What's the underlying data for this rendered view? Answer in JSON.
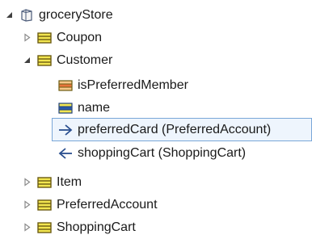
{
  "tree": {
    "root": {
      "label": "groceryStore",
      "icon": "package-icon",
      "expanded": true
    },
    "items": [
      {
        "label": "Coupon",
        "icon": "class-icon",
        "expanded": false
      },
      {
        "label": "Customer",
        "icon": "class-icon",
        "expanded": true,
        "children": [
          {
            "label": "isPreferredMember",
            "icon": "boolean-attribute-icon"
          },
          {
            "label": "name",
            "icon": "string-attribute-icon"
          },
          {
            "label": "preferredCard (PreferredAccount)",
            "icon": "reference-out-icon",
            "selected": true
          },
          {
            "label": "shoppingCart (ShoppingCart)",
            "icon": "reference-in-icon"
          }
        ]
      },
      {
        "label": "Item",
        "icon": "class-icon",
        "expanded": false
      },
      {
        "label": "PreferredAccount",
        "icon": "class-icon",
        "expanded": false
      },
      {
        "label": "ShoppingCart",
        "icon": "class-icon",
        "expanded": false
      }
    ]
  },
  "colors": {
    "class_fill": "#f2e650",
    "class_border": "#6b5b12",
    "boolean_attr": "#e8743b",
    "string_attr": "#2a5aa8",
    "reference": "#2a4f8f",
    "selection_border": "#7aa7d8",
    "selection_bg": "#eef5fd"
  }
}
